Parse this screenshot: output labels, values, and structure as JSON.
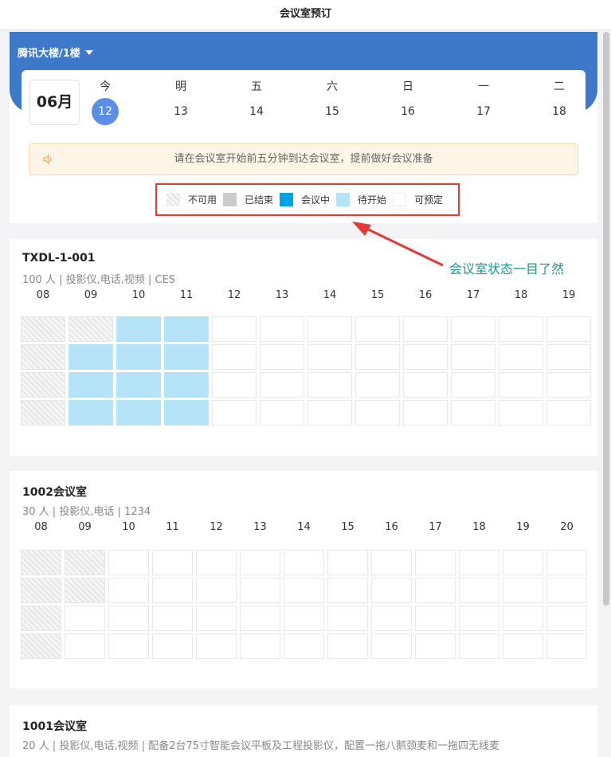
{
  "page_title": "会议室预订",
  "building": "腾讯大楼/1楼",
  "month": "06月",
  "days": [
    {
      "name": "今",
      "num": "12",
      "active": true
    },
    {
      "name": "明",
      "num": "13"
    },
    {
      "name": "五",
      "num": "14"
    },
    {
      "name": "六",
      "num": "15"
    },
    {
      "name": "日",
      "num": "16"
    },
    {
      "name": "一",
      "num": "17"
    },
    {
      "name": "二",
      "num": "18"
    }
  ],
  "notice": "请在会议室开始前五分钟到达会议室，提前做好会议准备",
  "legend": [
    {
      "key": "unavail",
      "label": "不可用"
    },
    {
      "key": "ended",
      "label": "已结束"
    },
    {
      "key": "ongoing",
      "label": "会议中"
    },
    {
      "key": "pending",
      "label": "待开始"
    },
    {
      "key": "bookable",
      "label": "可预定"
    }
  ],
  "annotation": "会议室状态一目了然",
  "colors": {
    "header_blue": "#3d78c9",
    "today_circle": "#5b8ee6",
    "ongoing": "#00a2e8",
    "pending": "#b5e4f8",
    "ended": "#cbcbcb",
    "annotation": "#1a9a8e",
    "highlight_red": "#e53935"
  },
  "rooms": [
    {
      "name": "TXDL-1-001",
      "info": "100 人 | 投影仪,电话,视频 | CES",
      "hours": [
        "08",
        "09",
        "10",
        "11",
        "12",
        "13",
        "14",
        "15",
        "16",
        "17",
        "18",
        "19"
      ],
      "rows": [
        [
          "unavail",
          "unavail",
          "pending",
          "pending",
          "free",
          "free",
          "free",
          "free",
          "free",
          "free",
          "free",
          "free"
        ],
        [
          "unavail",
          "pending",
          "pending",
          "pending",
          "free",
          "free",
          "free",
          "free",
          "free",
          "free",
          "free",
          "free"
        ],
        [
          "unavail",
          "pending",
          "pending",
          "pending",
          "free",
          "free",
          "free",
          "free",
          "free",
          "free",
          "free",
          "free"
        ],
        [
          "unavail",
          "pending",
          "pending",
          "pending",
          "free",
          "free",
          "free",
          "free",
          "free",
          "free",
          "free",
          "free"
        ]
      ]
    },
    {
      "name": "1002会议室",
      "info": "30 人 | 投影仪,电话 | 1234",
      "hours": [
        "08",
        "09",
        "10",
        "11",
        "12",
        "13",
        "14",
        "15",
        "16",
        "17",
        "18",
        "19",
        "20"
      ],
      "rows": [
        [
          "unavail",
          "unavail",
          "free",
          "free",
          "free",
          "free",
          "free",
          "free",
          "free",
          "free",
          "free",
          "free",
          "free"
        ],
        [
          "unavail",
          "unavail",
          "free",
          "free",
          "free",
          "free",
          "free",
          "free",
          "free",
          "free",
          "free",
          "free",
          "free"
        ],
        [
          "unavail",
          "free",
          "free",
          "free",
          "free",
          "free",
          "free",
          "free",
          "free",
          "free",
          "free",
          "free",
          "free"
        ],
        [
          "unavail",
          "free",
          "free",
          "free",
          "free",
          "free",
          "free",
          "free",
          "free",
          "free",
          "free",
          "free",
          "free"
        ]
      ]
    },
    {
      "name": "1001会议室",
      "info": "20 人 | 投影仪,电话,视频 | 配备2台75寸智能会议平板及工程投影仪，配置一拖八鹅颈麦和一拖四无线麦",
      "hours": [],
      "rows": []
    }
  ]
}
